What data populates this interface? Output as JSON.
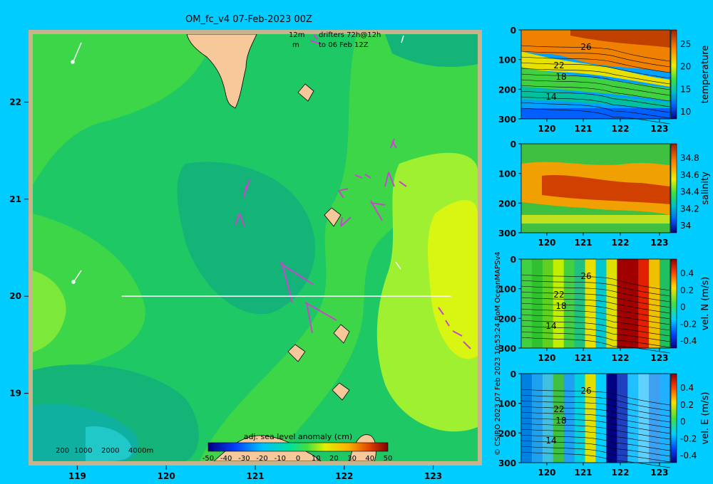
{
  "title": "OM_fc_v4  07-Feb-2023 00Z",
  "drifters_legend": {
    "line1_left": "12m",
    "line1_right": "drifters 72h@12h",
    "line2_left": "m",
    "line2_right": "to 06 Feb 12Z"
  },
  "watermark": "© CSIRO 2023   07 Feb 2023 10:53:24 BoM OceanMAPSv4",
  "depth_legend": [
    "200",
    "1000",
    "2000",
    "4000m"
  ],
  "map": {
    "lon_ticks": [
      "119",
      "120",
      "121",
      "122",
      "123"
    ],
    "lat_ticks": [
      "22",
      "21",
      "20",
      "19"
    ],
    "lon_range": [
      118.5,
      123.5
    ],
    "lat_range": [
      18.3,
      22.7
    ],
    "section_lat": 20,
    "section_lon": [
      119.5,
      123.2
    ]
  },
  "colorbar": {
    "label": "adj. sea level anomaly (cm)",
    "ticks": [
      "-50",
      "-40",
      "-30",
      "-20",
      "-10",
      "0",
      "10",
      "20",
      "30",
      "40",
      "50"
    ]
  },
  "panels": [
    {
      "id": "temperature",
      "ylabel": "temperature",
      "cbar_ticks": [
        "25",
        "20",
        "15",
        "10"
      ],
      "contour_labels": [
        "26",
        "22",
        "18",
        "14"
      ]
    },
    {
      "id": "salinity",
      "ylabel": "salinity",
      "cbar_ticks": [
        "34.8",
        "34.6",
        "34.4",
        "34.2",
        "34"
      ],
      "contour_labels": []
    },
    {
      "id": "velN",
      "ylabel": "vel. N (m/s)",
      "cbar_ticks": [
        "0.4",
        "0.2",
        "0",
        "-0.2",
        "-0.4"
      ],
      "contour_labels": [
        "26",
        "22",
        "18",
        "14"
      ]
    },
    {
      "id": "velE",
      "ylabel": "vel. E (m/s)",
      "cbar_ticks": [
        "0.4",
        "0.2",
        "0",
        "-0.2",
        "-0.4"
      ],
      "contour_labels": [
        "26",
        "22",
        "18",
        "14"
      ]
    }
  ],
  "section_y_ticks": [
    "0",
    "100",
    "200",
    "300"
  ],
  "section_x_ticks": [
    "120",
    "121",
    "122",
    "123"
  ],
  "colors": {
    "background": "#00ccff",
    "land": "#f7c89a",
    "frame": "#c8b48c",
    "section_line": "#ffffff",
    "drifter_arrow": "#cc44cc"
  }
}
